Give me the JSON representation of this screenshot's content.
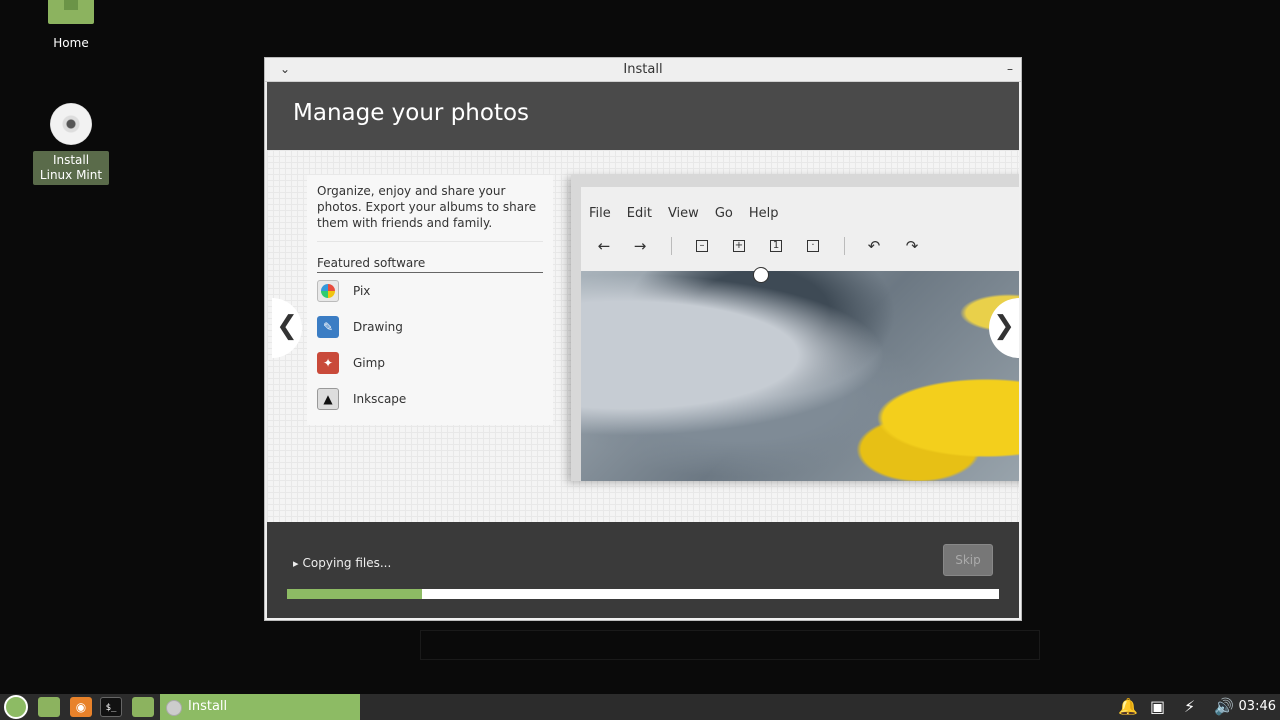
{
  "desktop": {
    "home_label": "Home",
    "install_label": "Install Linux Mint"
  },
  "window": {
    "title": "Install",
    "header": "Manage your photos",
    "description": "Organize, enjoy and share your photos. Export your albums to share them with friends and family.",
    "featured_label": "Featured software",
    "apps": [
      {
        "name": "Pix",
        "icon": "pix-icon"
      },
      {
        "name": "Drawing",
        "icon": "drawing-icon"
      },
      {
        "name": "Gimp",
        "icon": "gimp-icon"
      },
      {
        "name": "Inkscape",
        "icon": "inkscape-icon"
      }
    ],
    "nav_prev": "❮",
    "nav_next": "❯",
    "preview": {
      "menu": [
        "File",
        "Edit",
        "View",
        "Go",
        "Help"
      ]
    },
    "status_text": "Copying files...",
    "skip_label": "Skip",
    "progress": 0.19
  },
  "taskbar": {
    "task_label": "Install",
    "clock": "03:46"
  },
  "colors": {
    "accent": "#8dbb64",
    "header_bg": "#4a4a4a",
    "bottom_bg": "#3a3a3a"
  }
}
